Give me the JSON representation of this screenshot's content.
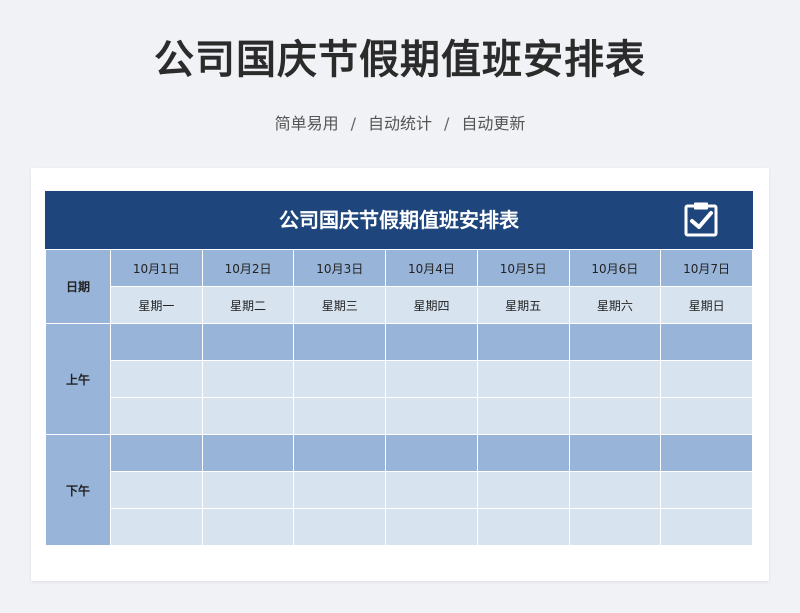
{
  "title": "公司国庆节假期值班安排表",
  "subtitle": {
    "items": [
      "简单易用",
      "自动统计",
      "自动更新"
    ],
    "separator": "/"
  },
  "sheet": {
    "banner_title": "公司国庆节假期值班安排表",
    "banner_icon": "clipboard-check-icon",
    "colors": {
      "banner": "#1f467c",
      "header_dark": "#98b4d9",
      "header_light": "#d8e3f0"
    },
    "row_labels": {
      "date": "日期",
      "morning": "上午",
      "afternoon": "下午"
    },
    "dates": [
      "10月1日",
      "10月2日",
      "10月3日",
      "10月4日",
      "10月5日",
      "10月6日",
      "10月7日"
    ],
    "weekdays": [
      "星期一",
      "星期二",
      "星期三",
      "星期四",
      "星期五",
      "星期六",
      "星期日"
    ]
  }
}
